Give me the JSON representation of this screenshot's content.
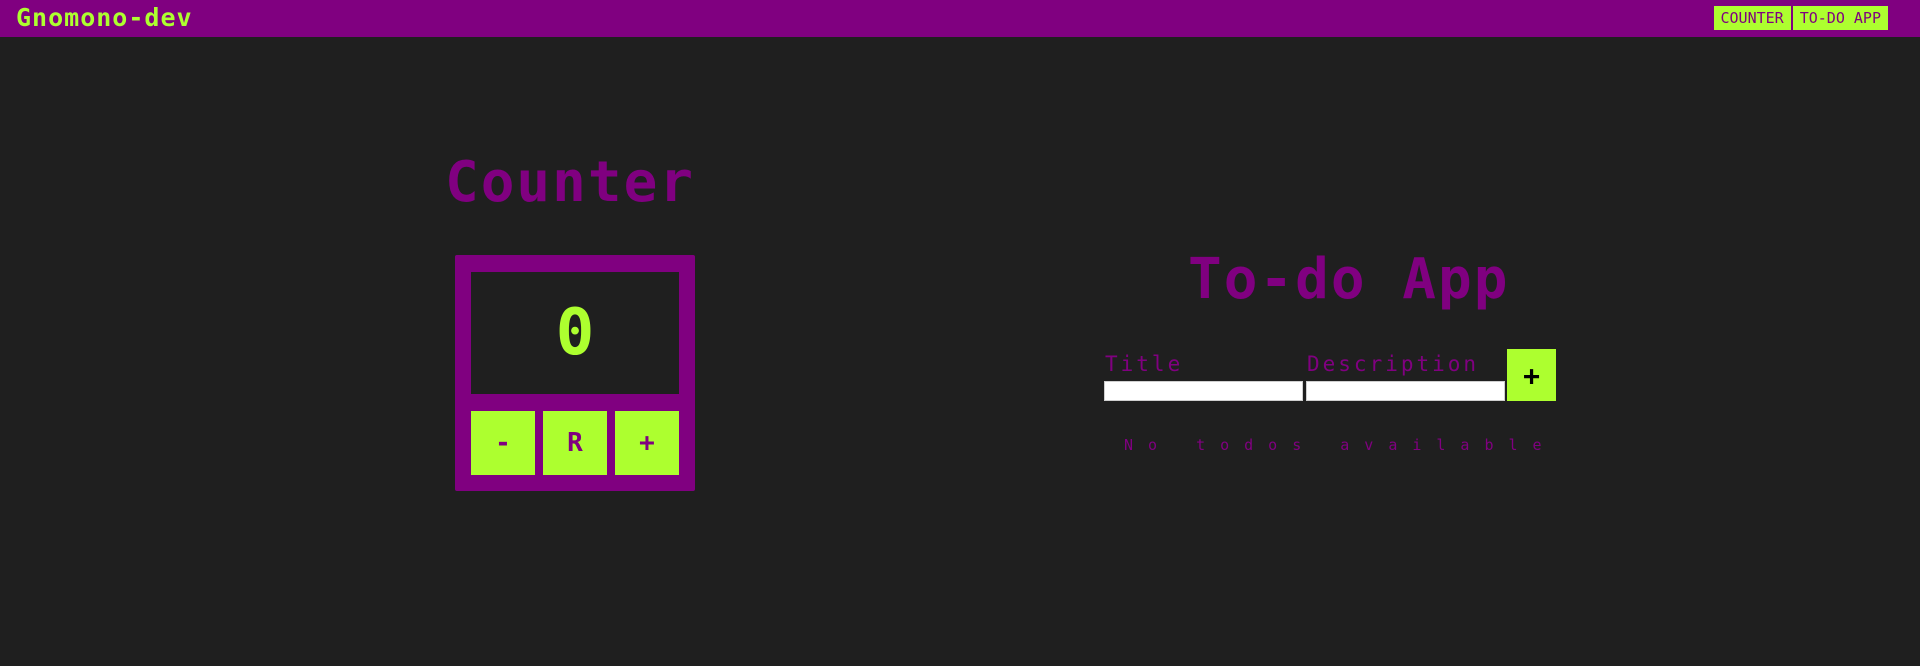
{
  "header": {
    "brand": "Gnomono-dev",
    "nav": [
      "COUNTER",
      "TO-DO APP"
    ]
  },
  "counter": {
    "title": "Counter",
    "value": "0",
    "buttons": {
      "decrement": "-",
      "reset": "R",
      "increment": "+"
    }
  },
  "todo": {
    "title": "To-do App",
    "title_label": "Title",
    "title_value": "",
    "description_label": "Description",
    "description_value": "",
    "add_label": "+",
    "empty_message": "No todos available"
  },
  "colors": {
    "background": "#1f1f1f",
    "primary": "#800080",
    "accent": "#adff2f"
  }
}
